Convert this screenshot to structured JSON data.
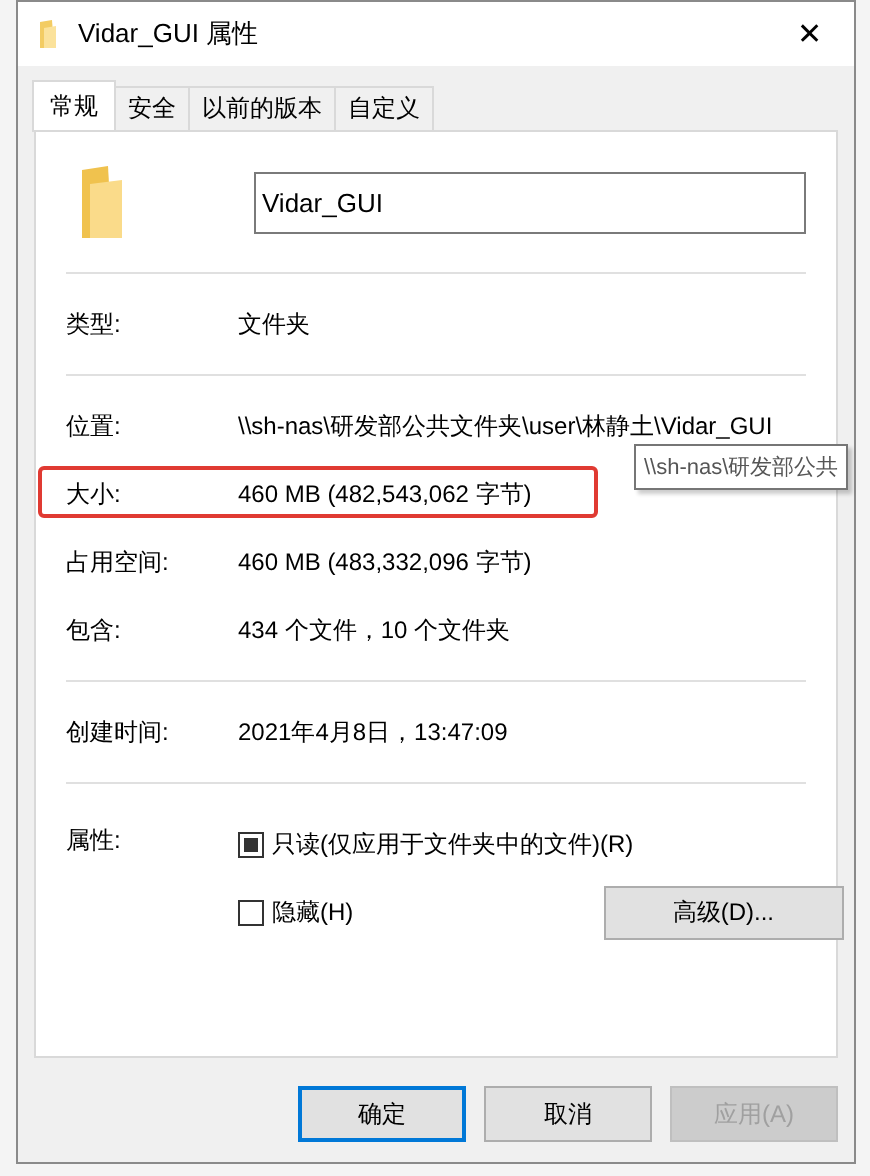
{
  "window": {
    "title": "Vidar_GUI 属性",
    "close": "✕"
  },
  "tabs": [
    {
      "label": "常规",
      "selected": true
    },
    {
      "label": "安全",
      "selected": false
    },
    {
      "label": "以前的版本",
      "selected": false
    },
    {
      "label": "自定义",
      "selected": false
    }
  ],
  "name_field": {
    "value": "Vidar_GUI"
  },
  "groups": [
    [
      {
        "label": "类型:",
        "value": "文件夹",
        "highlight": false
      }
    ],
    [
      {
        "label": "位置:",
        "value": "\\\\sh-nas\\研发部公共文件夹\\user\\林静土\\Vidar_GUI",
        "highlight": false
      },
      {
        "label": "大小:",
        "value": "460 MB (482,543,062 字节)",
        "highlight": true
      },
      {
        "label": "占用空间:",
        "value": "460 MB (483,332,096 字节)",
        "highlight": false
      },
      {
        "label": "包含:",
        "value": "434 个文件，10 个文件夹",
        "highlight": false
      }
    ],
    [
      {
        "label": "创建时间:",
        "value": "2021年4月8日，13:47:09",
        "highlight": false
      }
    ]
  ],
  "tooltip": "\\\\sh-nas\\研发部公共",
  "attributes": {
    "label": "属性:",
    "options": [
      {
        "label": "只读(仅应用于文件夹中的文件)(R)",
        "checked": false,
        "indeterminate": true
      },
      {
        "label": "隐藏(H)",
        "checked": false,
        "indeterminate": false
      }
    ],
    "advanced": "高级(D)..."
  },
  "buttons": [
    {
      "label": "确定",
      "default": true,
      "disabled": false
    },
    {
      "label": "取消",
      "default": false,
      "disabled": false
    },
    {
      "label": "应用(A)",
      "default": false,
      "disabled": true
    }
  ]
}
